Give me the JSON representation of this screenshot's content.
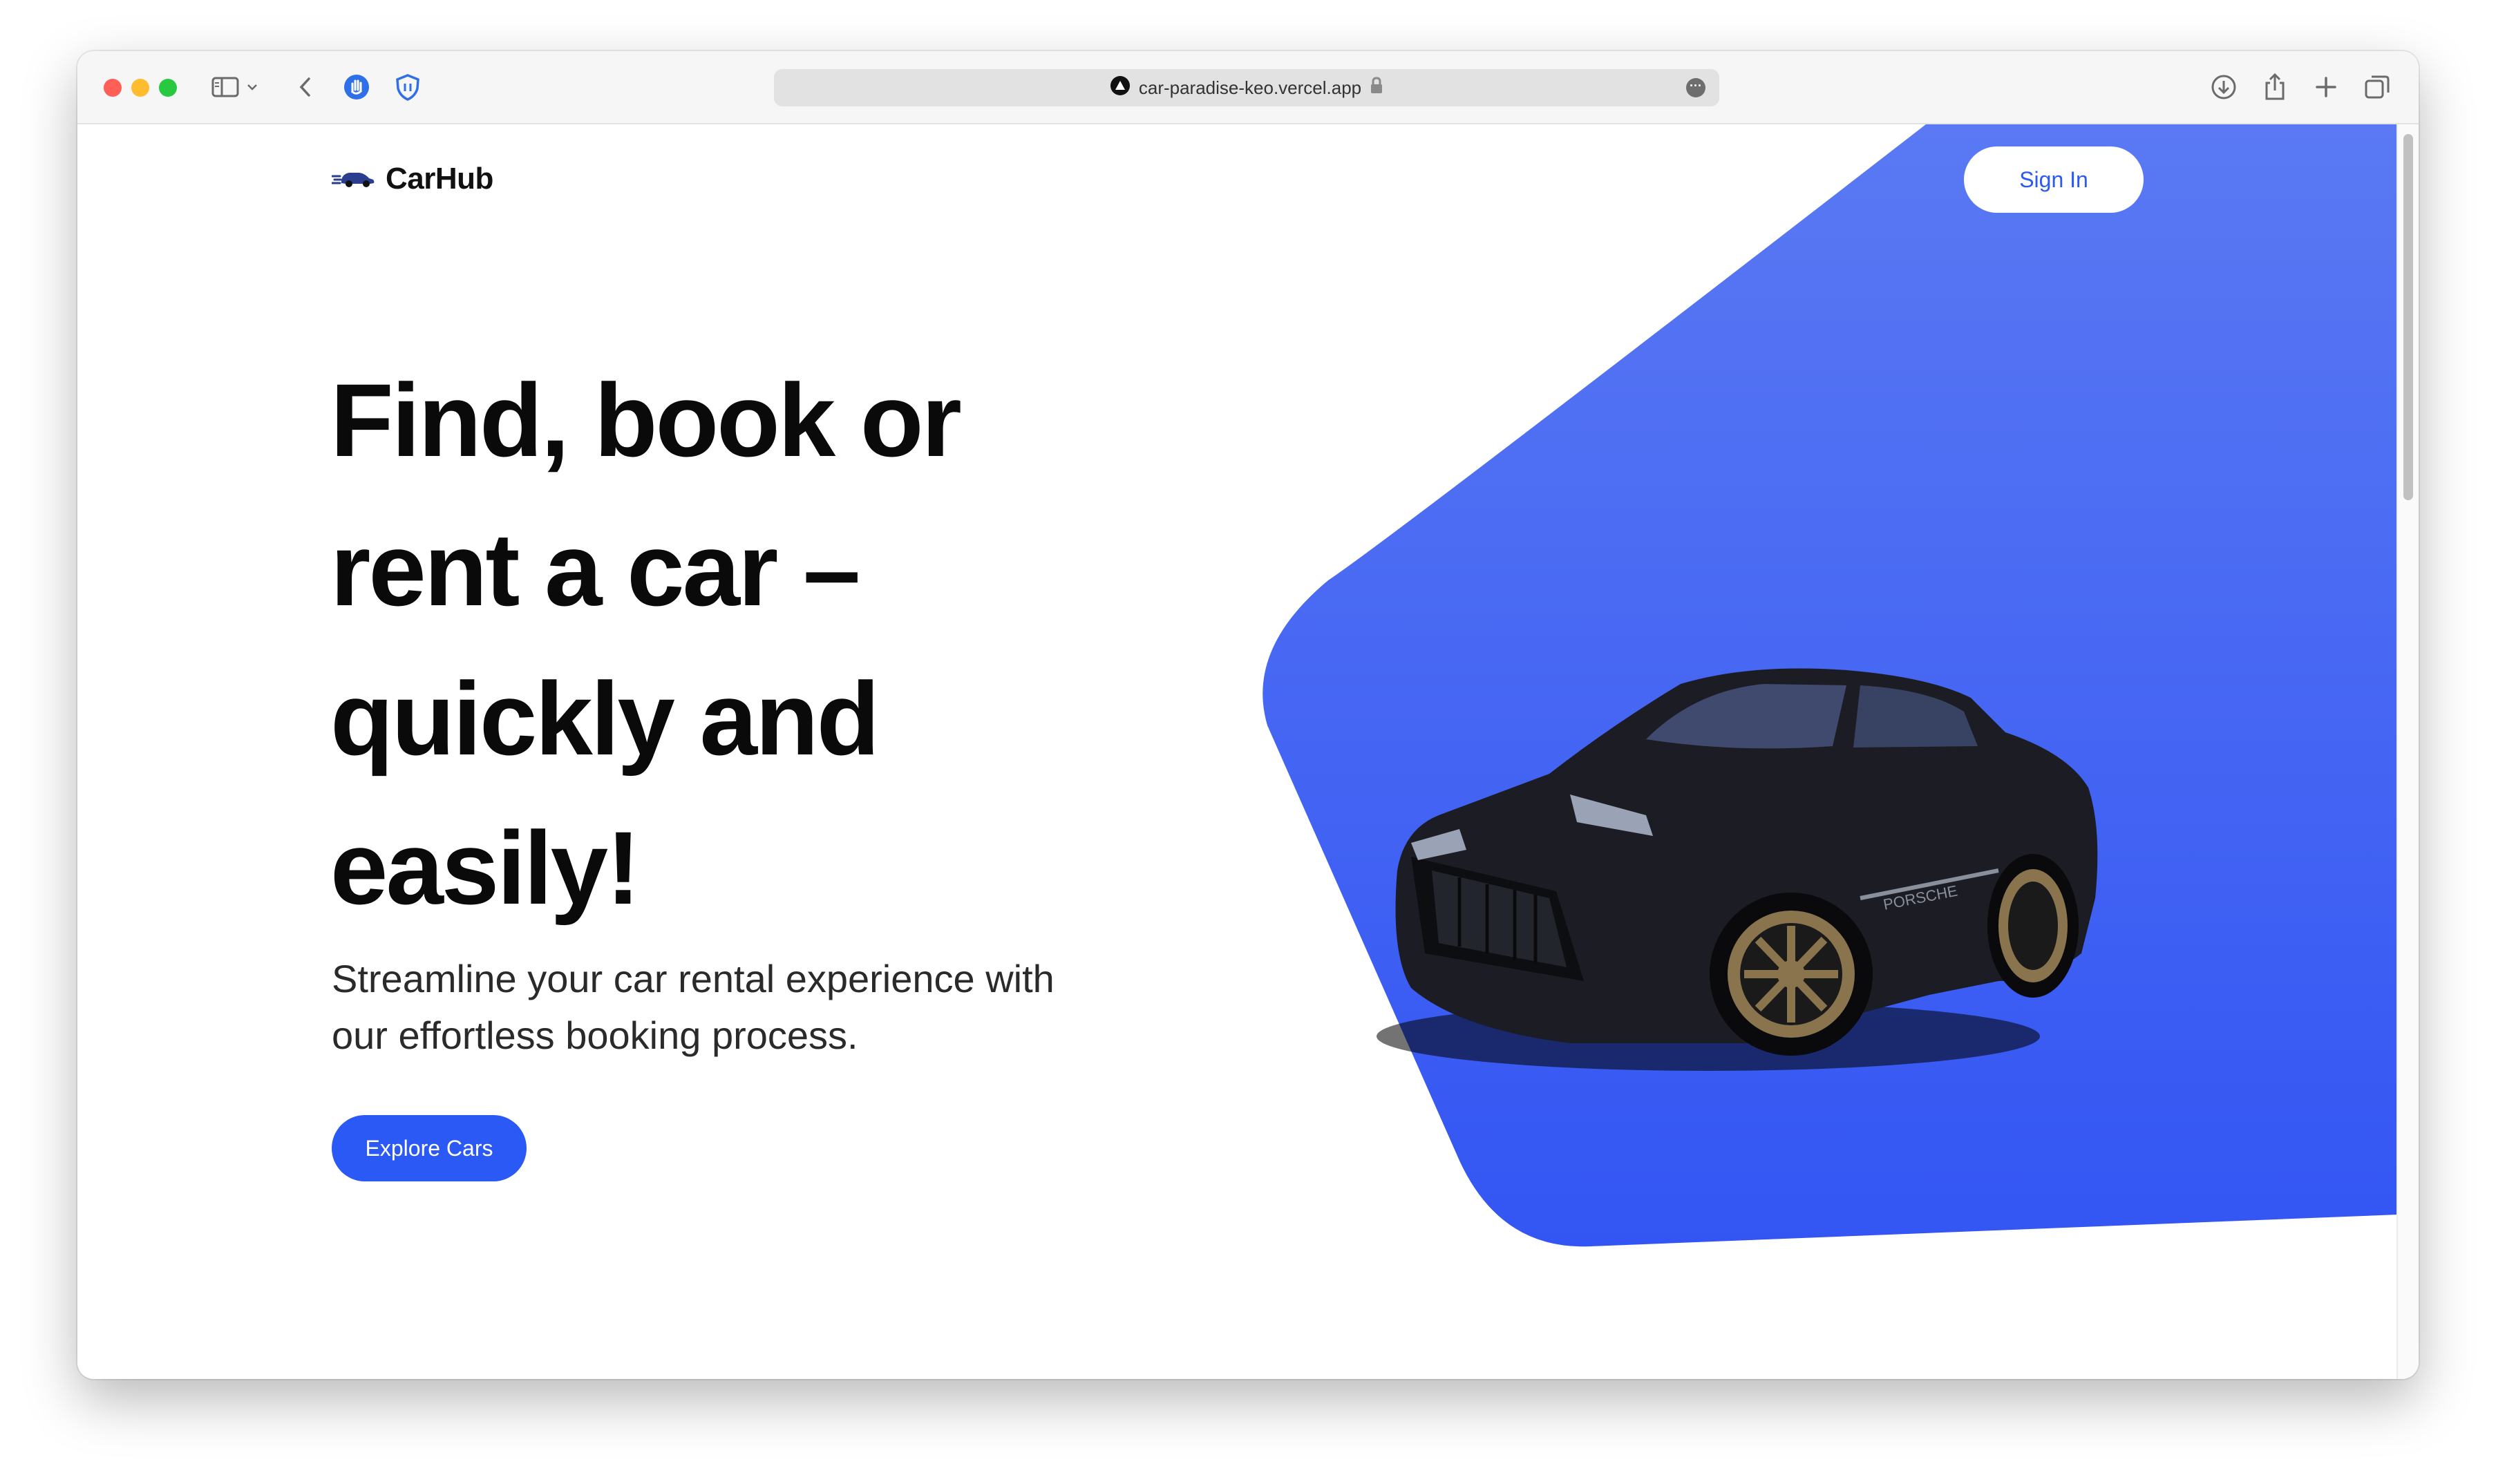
{
  "browser": {
    "url": "car-paradise-keo.vercel.app",
    "icons": [
      "sidebar-icon",
      "chevron-down-icon",
      "back-icon",
      "privacy-hand-icon",
      "shield-icon",
      "lock-icon",
      "more-icon",
      "download-icon",
      "share-icon",
      "new-tab-icon",
      "tabs-overview-icon"
    ]
  },
  "page": {
    "logo_text": "CarHub",
    "signin_label": "Sign In",
    "headline": "Find, book or rent a car – quickly and easily!",
    "subtitle": "Streamline your car rental experience with our effortless booking process.",
    "cta_label": "Explore Cars",
    "car_badge": "PORSCHE"
  },
  "colors": {
    "accent": "#2b59f5",
    "hero_gradient_top": "#5a79f3",
    "hero_gradient_bottom": "#3355f3",
    "text_dark": "#0a0a0a"
  }
}
